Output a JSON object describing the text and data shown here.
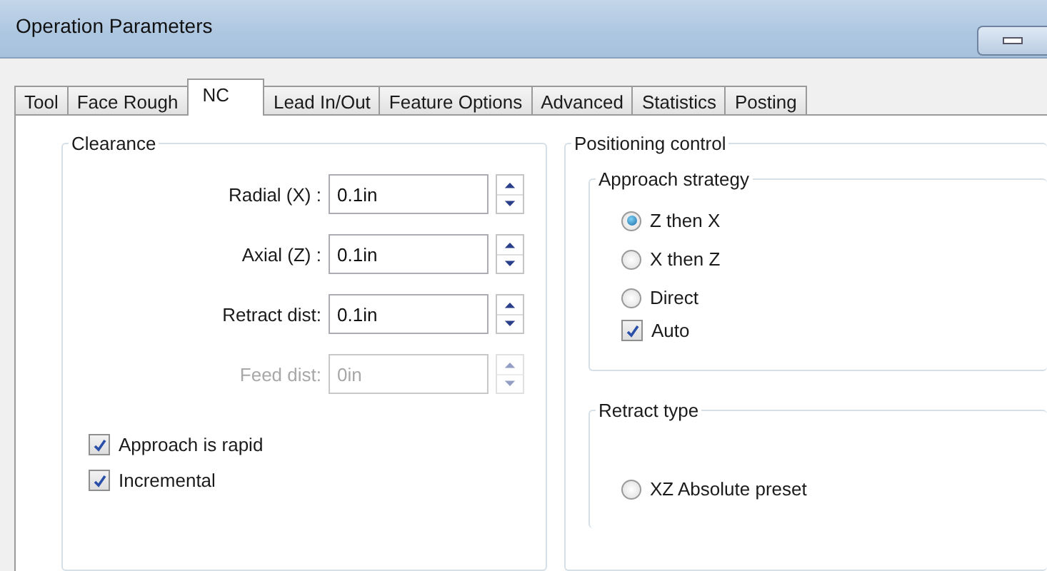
{
  "window": {
    "title": "Operation Parameters"
  },
  "tabs": [
    {
      "label": "Tool",
      "selected": false
    },
    {
      "label": "Face Rough",
      "selected": false
    },
    {
      "label": "NC",
      "selected": true
    },
    {
      "label": "Lead In/Out",
      "selected": false
    },
    {
      "label": "Feature Options",
      "selected": false
    },
    {
      "label": "Advanced",
      "selected": false
    },
    {
      "label": "Statistics",
      "selected": false
    },
    {
      "label": "Posting",
      "selected": false
    }
  ],
  "clearance": {
    "title": "Clearance",
    "fields": [
      {
        "label": "Radial (X) :",
        "value": "0.1in",
        "disabled": false
      },
      {
        "label": "Axial (Z) :",
        "value": "0.1in",
        "disabled": false
      },
      {
        "label": "Retract dist:",
        "value": "0.1in",
        "disabled": false
      },
      {
        "label": "Feed dist:",
        "value": "0in",
        "disabled": true
      }
    ],
    "checkboxes": [
      {
        "label": "Approach is rapid",
        "checked": true
      },
      {
        "label": "Incremental",
        "checked": true
      }
    ]
  },
  "positioning_control": {
    "title": "Positioning control",
    "approach_strategy": {
      "title": "Approach strategy",
      "options": [
        {
          "label": "Z then X",
          "selected": true
        },
        {
          "label": "X then Z",
          "selected": false
        },
        {
          "label": "Direct",
          "selected": false
        }
      ],
      "auto": {
        "label": "Auto",
        "checked": true
      }
    },
    "retract_type": {
      "title": "Retract type",
      "options": [
        {
          "label": "XZ Absolute preset",
          "selected": false
        }
      ]
    }
  }
}
